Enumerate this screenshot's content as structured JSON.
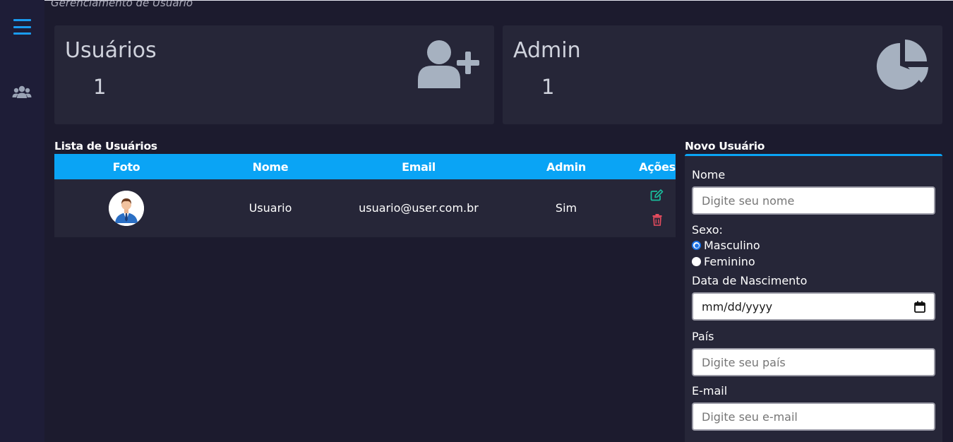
{
  "page": {
    "title": "Gerenciamento de Usuário"
  },
  "sidebar": {
    "items": [
      {
        "icon": "menu-icon"
      },
      {
        "icon": "users-icon"
      }
    ]
  },
  "cards": [
    {
      "title": "Usuários",
      "value": "1",
      "icon": "user-plus-icon"
    },
    {
      "title": "Admin",
      "value": "1",
      "icon": "pie-chart-icon"
    }
  ],
  "users_list": {
    "title": "Lista de Usuários",
    "columns": [
      "Foto",
      "Nome",
      "Email",
      "Admin",
      "Ações"
    ],
    "rows": [
      {
        "photo": "avatar-icon",
        "name": "Usuario",
        "email": "usuario@user.com.br",
        "admin": "Sim",
        "actions": [
          "edit-icon",
          "trash-icon"
        ]
      }
    ]
  },
  "new_user_form": {
    "title": "Novo Usuário",
    "name_label": "Nome",
    "name_placeholder": "Digite seu nome",
    "sex_label": "Sexo:",
    "sex_options": [
      "Masculino",
      "Feminino"
    ],
    "sex_selected": "Masculino",
    "birth_label": "Data de Nascimento",
    "birth_placeholder": "mm/dd/yyyy",
    "country_label": "País",
    "country_placeholder": "Digite seu país",
    "email_label": "E-mail",
    "email_placeholder": "Digite seu e-mail"
  },
  "colors": {
    "accent": "#0aa4f5",
    "background": "#1c1b2e",
    "card": "#262638",
    "edit": "#1abc9c",
    "delete": "#e74c5e"
  }
}
